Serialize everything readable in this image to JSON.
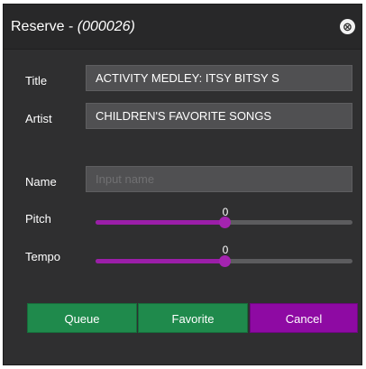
{
  "dialog": {
    "title_prefix": "Reserve - ",
    "title_code": "(000026)",
    "close_glyph": "⊗"
  },
  "form": {
    "title_label": "Title",
    "title_value": "ACTIVITY MEDLEY: ITSY BITSY S",
    "artist_label": "Artist",
    "artist_value": "CHILDREN'S FAVORITE SONGS",
    "name_label": "Name",
    "name_value": "",
    "name_placeholder": "Input name"
  },
  "sliders": {
    "pitch": {
      "label": "Pitch",
      "value": "0",
      "min": -5,
      "max": 5,
      "current": 0
    },
    "tempo": {
      "label": "Tempo",
      "value": "0",
      "min": -5,
      "max": 5,
      "current": 0
    }
  },
  "buttons": {
    "queue": "Queue",
    "favorite": "Favorite",
    "cancel": "Cancel"
  },
  "colors": {
    "accent_purple": "#9b1ea8",
    "green_button": "#1f8a4c",
    "purple_button": "#8e0aa3"
  },
  "icons": {
    "close": "close-circle-icon"
  }
}
